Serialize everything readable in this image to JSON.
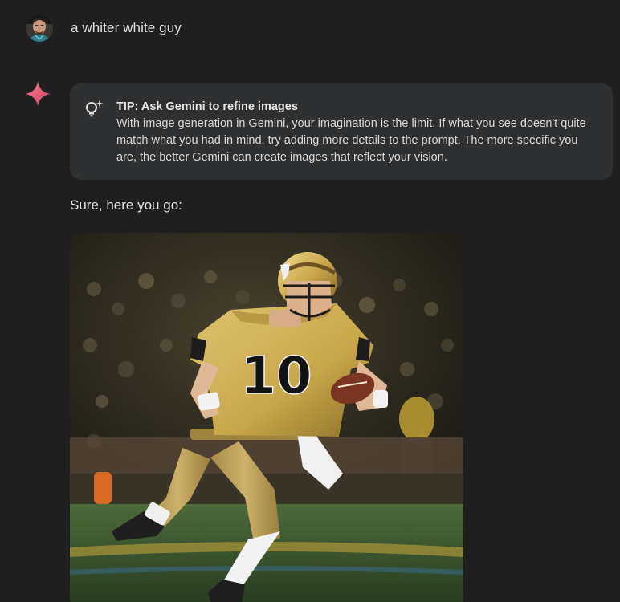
{
  "user": {
    "prompt": "a whiter white guy",
    "avatar_icon": "user-avatar"
  },
  "assistant": {
    "icon": "gemini-spark-icon",
    "tip": {
      "icon": "lightbulb-sparkle-icon",
      "title": "TIP: Ask Gemini to refine images",
      "body": "With image generation in Gemini, your imagination is the limit. If what you see doesn't quite match what you had in mind, try adding more details to the prompt. The more specific you are, the better Gemini can create images that reflect your vision."
    },
    "response_text": "Sure, here you go:",
    "image": {
      "jersey_number": "10"
    }
  },
  "colors": {
    "background": "#1f1f20",
    "card": "#2f3031",
    "text": "#e3e3e3",
    "gold": "#c8a64a"
  }
}
